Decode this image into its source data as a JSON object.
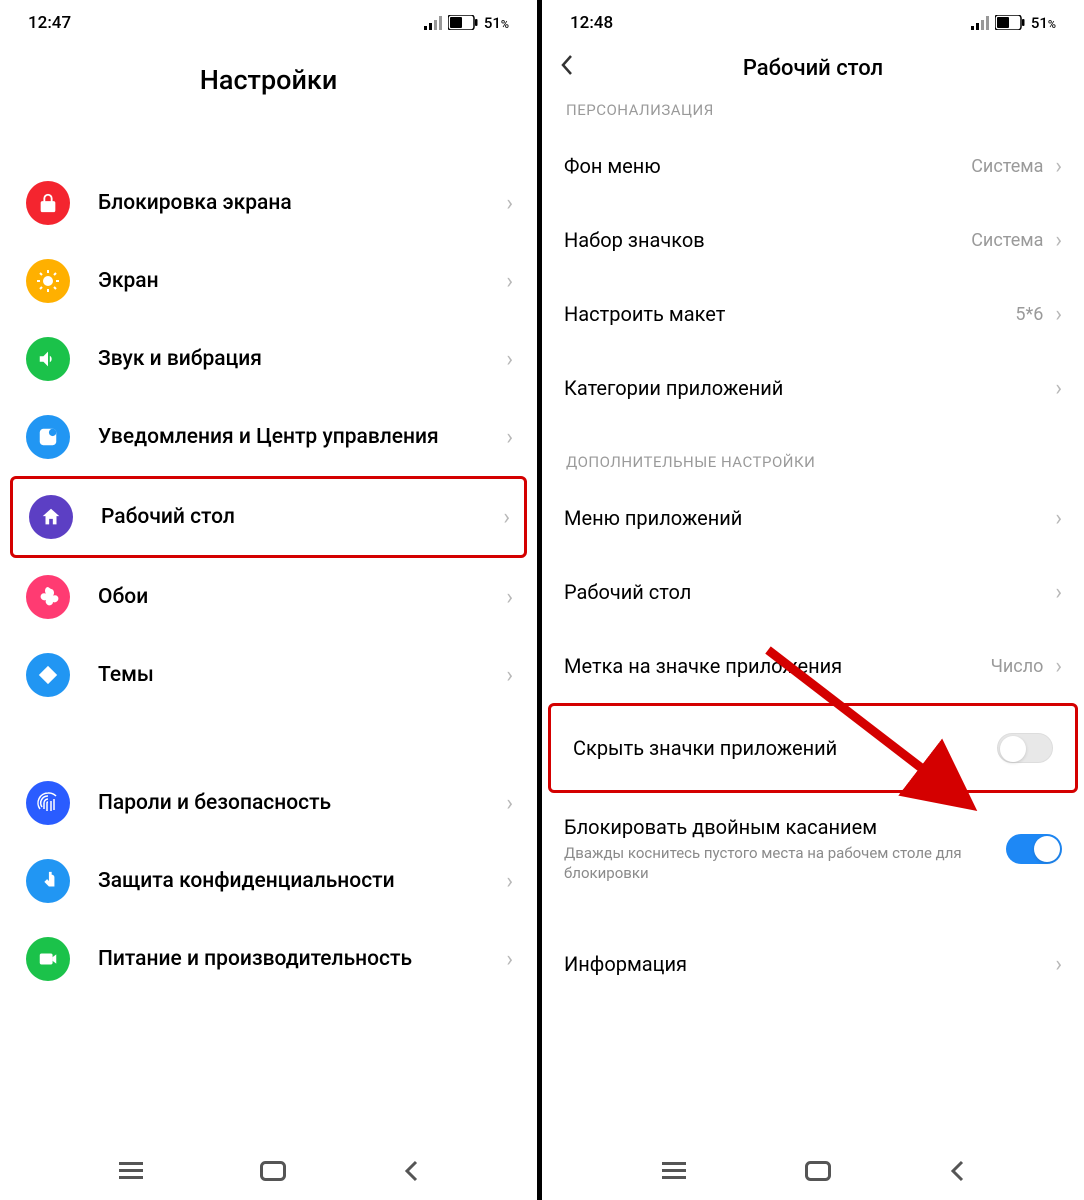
{
  "left": {
    "time": "12:47",
    "battery": "51",
    "title": "Настройки",
    "items": [
      {
        "label": "Блокировка экрана",
        "icon": "lock",
        "bg": "bg-lock"
      },
      {
        "label": "Экран",
        "icon": "sun",
        "bg": "bg-screen"
      },
      {
        "label": "Звук и вибрация",
        "icon": "speaker",
        "bg": "bg-sound"
      },
      {
        "label": "Уведомления и Центр управления",
        "icon": "notif",
        "bg": "bg-notif"
      },
      {
        "label": "Рабочий стол",
        "icon": "home",
        "bg": "bg-home",
        "highlighted": true
      },
      {
        "label": "Обои",
        "icon": "flower",
        "bg": "bg-wall"
      },
      {
        "label": "Темы",
        "icon": "diamond",
        "bg": "bg-theme"
      }
    ],
    "items2": [
      {
        "label": "Пароли и безопасность",
        "icon": "finger",
        "bg": "bg-pass"
      },
      {
        "label": "Защита конфиденциальности",
        "icon": "hand",
        "bg": "bg-priv"
      },
      {
        "label": "Питание и производительность",
        "icon": "camera",
        "bg": "bg-power"
      }
    ]
  },
  "right": {
    "time": "12:48",
    "battery": "51",
    "title": "Рабочий стол",
    "sect1": "ПЕРСОНАЛИЗАЦИЯ",
    "rows1": [
      {
        "label": "Фон меню",
        "value": "Система"
      },
      {
        "label": "Набор значков",
        "value": "Система"
      },
      {
        "label": "Настроить макет",
        "value": "5*6"
      },
      {
        "label": "Категории приложений",
        "value": ""
      }
    ],
    "sect2": "ДОПОЛНИТЕЛЬНЫЕ НАСТРОЙКИ",
    "rows2": [
      {
        "label": "Меню приложений"
      },
      {
        "label": "Рабочий стол"
      },
      {
        "label": "Метка на значке приложения",
        "value": "Число"
      }
    ],
    "hide_row": "Скрыть значки приложений",
    "lock_row": {
      "label": "Блокировать двойным касанием",
      "sub": "Дважды коснитесь пустого места на рабочем столе для блокировки"
    },
    "info_row": "Информация"
  }
}
